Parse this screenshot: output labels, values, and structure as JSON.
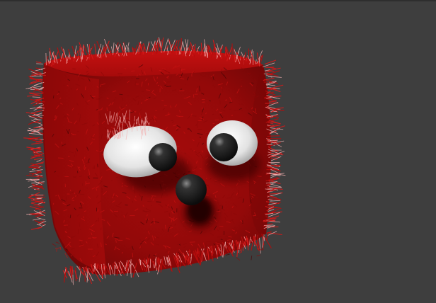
{
  "scene": {
    "background_color": "#3e3e3e",
    "subject": "furry-red-cube-creature",
    "fur_color": "#b80d0d",
    "fur_highlight_color": "#f4b0b0",
    "fur_shadow_color": "#4a0505",
    "eye_white_color": "#e8e8e8",
    "pupil_color": "#1a1a1a",
    "nose_color": "#1a1a1a"
  }
}
